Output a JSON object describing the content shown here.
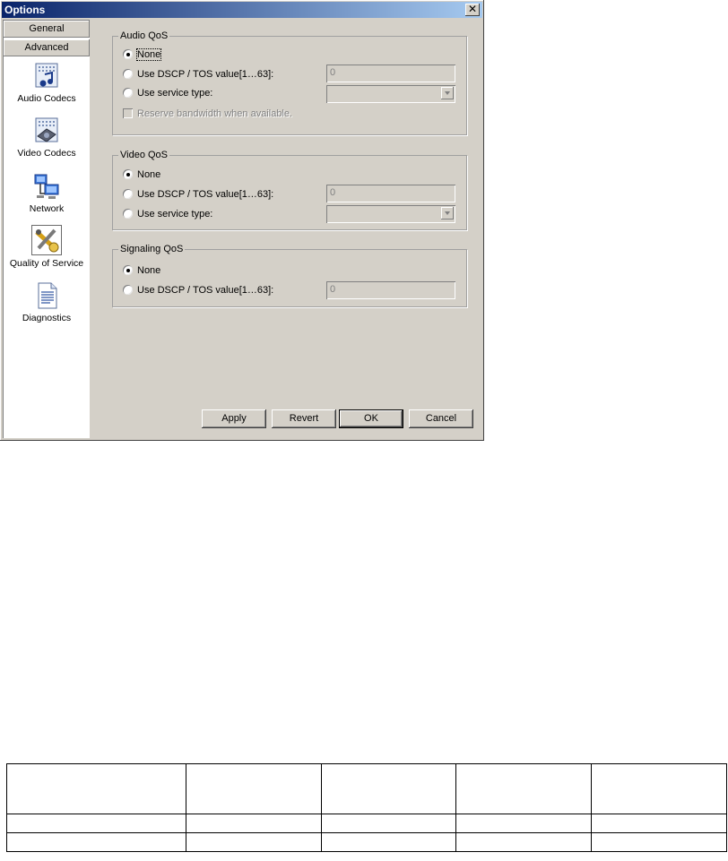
{
  "window": {
    "title": "Options",
    "close_glyph": "✕"
  },
  "sidebar": {
    "categories": [
      {
        "label": "General"
      },
      {
        "label": "Advanced"
      }
    ],
    "items": [
      {
        "label": "Audio Codecs",
        "icon": "audio-codecs-icon"
      },
      {
        "label": "Video Codecs",
        "icon": "video-codecs-icon"
      },
      {
        "label": "Network",
        "icon": "network-icon"
      },
      {
        "label": "Quality of Service",
        "icon": "quality-of-service-icon"
      },
      {
        "label": "Diagnostics",
        "icon": "diagnostics-icon"
      }
    ]
  },
  "audio_qos": {
    "title": "Audio QoS",
    "none_label": "None",
    "dscp_label": "Use DSCP / TOS value[1…63]:",
    "dscp_value": "0",
    "service_label": "Use service type:",
    "service_value": "",
    "reserve_label": "Reserve bandwidth when available.",
    "selected": "None"
  },
  "video_qos": {
    "title": "Video QoS",
    "none_label": "None",
    "dscp_label": "Use DSCP / TOS value[1…63]:",
    "dscp_value": "0",
    "service_label": "Use service type:",
    "service_value": "",
    "selected": "None"
  },
  "signaling_qos": {
    "title": "Signaling QoS",
    "none_label": "None",
    "dscp_label": "Use DSCP / TOS value[1…63]:",
    "dscp_value": "0",
    "selected": "None"
  },
  "buttons": {
    "apply": "Apply",
    "revert": "Revert",
    "ok": "OK",
    "cancel": "Cancel"
  },
  "table": {
    "columns": [
      "",
      "",
      "",
      "",
      ""
    ],
    "rows": [
      [
        "",
        "",
        "",
        "",
        ""
      ],
      [
        "",
        "",
        "",
        "",
        ""
      ]
    ]
  }
}
